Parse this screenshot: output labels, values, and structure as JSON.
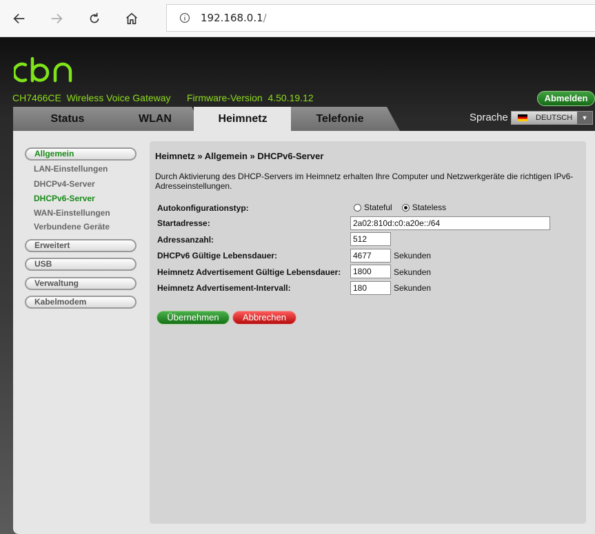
{
  "browser": {
    "url_main": "192.168.0.1",
    "url_suffix": "/"
  },
  "header": {
    "logo": "cbn",
    "model": "CH7466CE  Wireless Voice Gateway",
    "firmware": "Firmware-Version  4.50.19.12",
    "logout_label": "Abmelden",
    "language_label": "Sprache",
    "language_value": "DEUTSCH"
  },
  "tabs": [
    {
      "label": "Status"
    },
    {
      "label": "WLAN"
    },
    {
      "label": "Heimnetz"
    },
    {
      "label": "Telefonie"
    }
  ],
  "sidebar": {
    "allgemein": "Allgemein",
    "sub": [
      {
        "label": "LAN-Einstellungen"
      },
      {
        "label": "DHCPv4-Server"
      },
      {
        "label": "DHCPv6-Server"
      },
      {
        "label": "WAN-Einstellungen"
      },
      {
        "label": "Verbundene Geräte"
      }
    ],
    "erweitert": "Erweitert",
    "usb": "USB",
    "verwaltung": "Verwaltung",
    "kabelmodem": "Kabelmodem"
  },
  "main": {
    "breadcrumb": "Heimnetz » Allgemein » DHCPv6-Server",
    "description": "Durch Aktivierung des DHCP-Servers im Heimnetz erhalten Ihre Computer und Netzwerkgeräte die richtigen IPv6-Adresseinstellungen.",
    "autoconfig_label": "Autokonfigurationstyp:",
    "radio_stateful": "Stateful",
    "radio_stateless": "Stateless",
    "start_label": "Startadresse:",
    "start_value": "2a02:810d:c0:a20e::/64",
    "count_label": "Adressanzahl:",
    "count_value": "512",
    "lifetime_label": "DHCPv6 Gültige Lebensdauer:",
    "lifetime_value": "4677",
    "adv_lifetime_label": "Heimnetz Advertisement Gültige Lebensdauer:",
    "adv_lifetime_value": "1800",
    "adv_interval_label": "Heimnetz Advertisement-Intervall:",
    "adv_interval_value": "180",
    "unit": "Sekunden",
    "apply_label": "Übernehmen",
    "cancel_label": "Abbrechen"
  },
  "colors": {
    "brand_green": "#8fdc1e",
    "active_green": "#178a17"
  }
}
